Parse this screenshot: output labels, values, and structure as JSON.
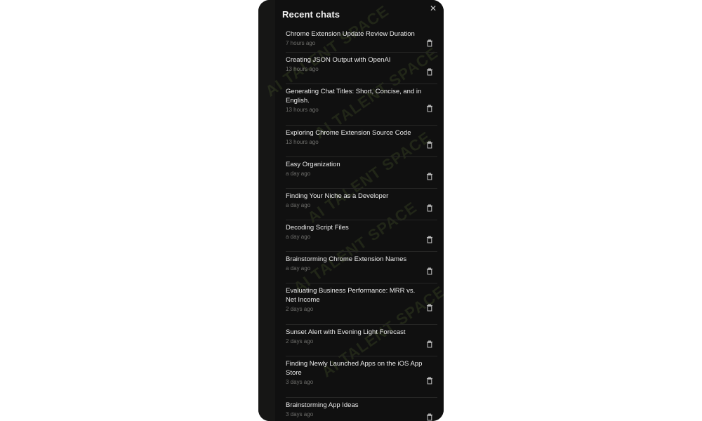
{
  "header": {
    "title": "Recent chats"
  },
  "close_icon": "close-icon",
  "trash_icon": "trash-icon",
  "watermark": "AI TALENT SPACE",
  "chats": [
    {
      "title": "Chrome Extension Update Review Duration",
      "time": "7 hours ago"
    },
    {
      "title": "Creating JSON Output with OpenAI",
      "time": "13 hours ago"
    },
    {
      "title": "Generating Chat Titles: Short, Concise, and in English.",
      "time": "13 hours ago"
    },
    {
      "title": "Exploring Chrome Extension Source Code",
      "time": "13 hours ago"
    },
    {
      "title": "Easy Organization",
      "time": "a day ago"
    },
    {
      "title": "Finding Your Niche as a Developer",
      "time": "a day ago"
    },
    {
      "title": "Decoding Script Files",
      "time": "a day ago"
    },
    {
      "title": "Brainstorming Chrome Extension Names",
      "time": "a day ago"
    },
    {
      "title": "Evaluating Business Performance: MRR vs. Net Income",
      "time": "2 days ago"
    },
    {
      "title": "Sunset Alert with Evening Light Forecast",
      "time": "2 days ago"
    },
    {
      "title": "Finding Newly Launched Apps on the iOS App Store",
      "time": "3 days ago"
    },
    {
      "title": "Brainstorming App Ideas",
      "time": "3 days ago"
    }
  ]
}
